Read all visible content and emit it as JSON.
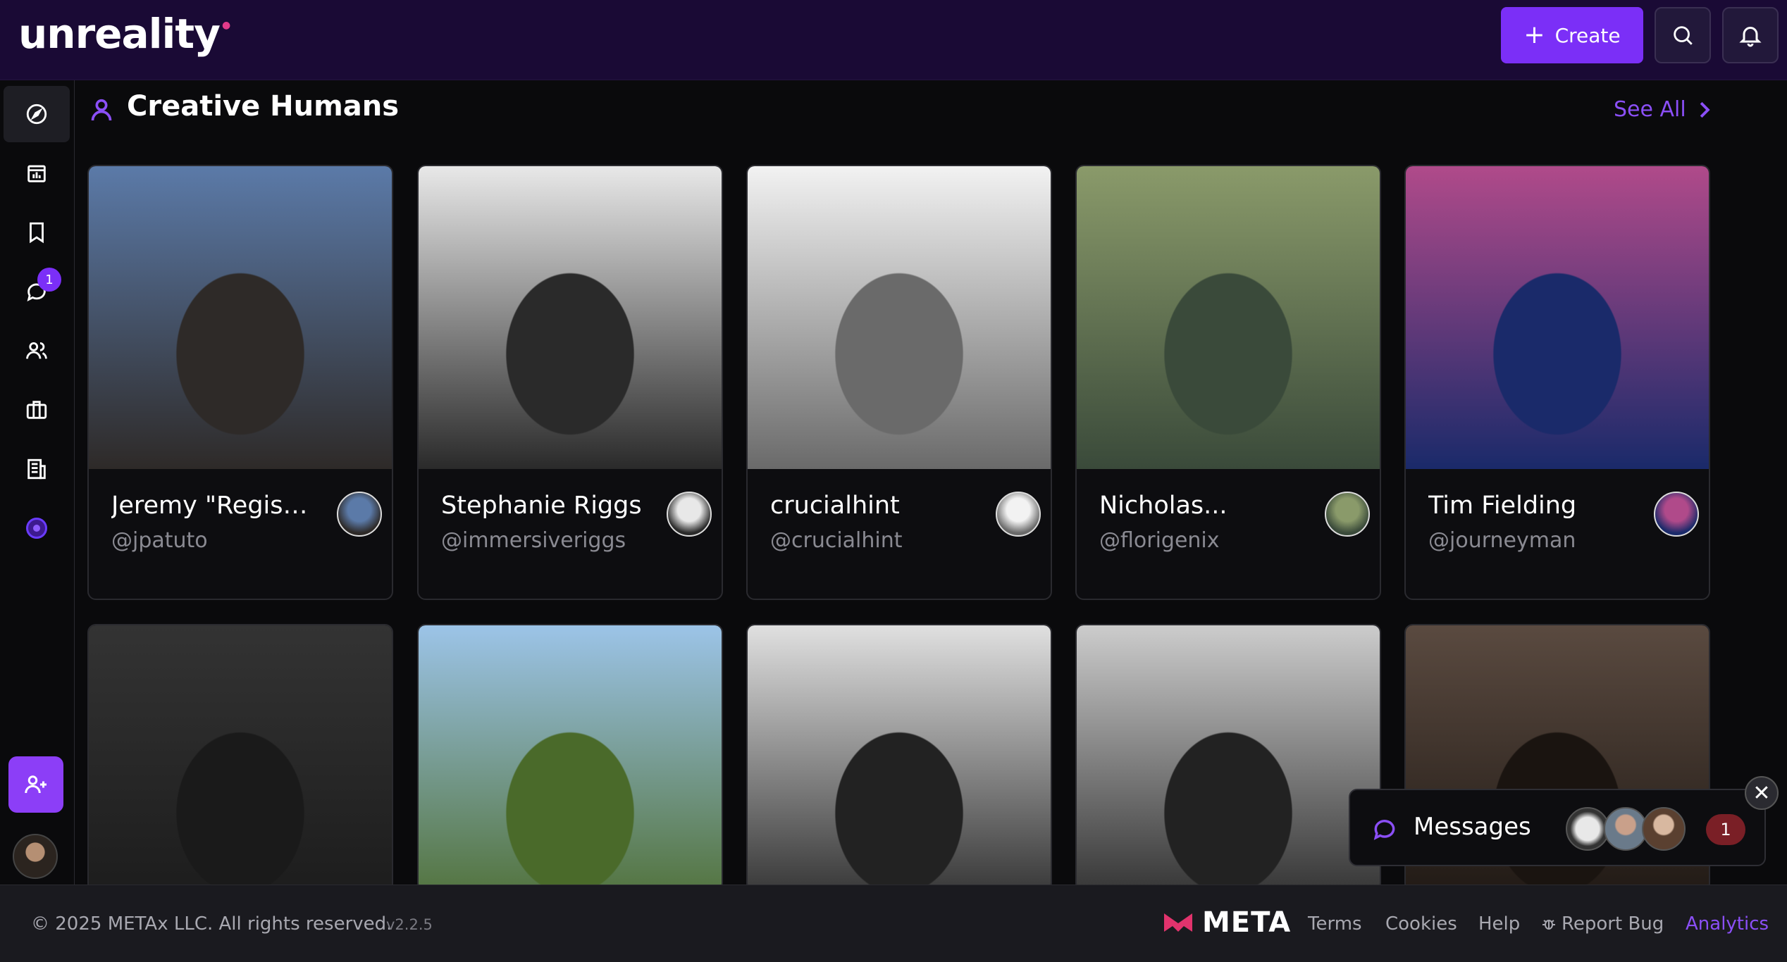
{
  "header": {
    "logo": "unreality",
    "create_label": "Create"
  },
  "sidebar": {
    "messages_badge": "1"
  },
  "section": {
    "title": "Creative Humans",
    "see_all": "See All"
  },
  "creators": [
    {
      "name": "Jeremy \"Regis\"...",
      "handle": "@jpatuto",
      "colors": [
        "#5b7aa8",
        "#2e2a28"
      ]
    },
    {
      "name": "Stephanie Riggs",
      "handle": "@immersiveriggs",
      "colors": [
        "#e8e8e8",
        "#2a2a2a"
      ]
    },
    {
      "name": "crucialhint",
      "handle": "@crucialhint",
      "colors": [
        "#f2f2f2",
        "#6a6a6a"
      ]
    },
    {
      "name": "Nicholas...",
      "handle": "@florigenix",
      "colors": [
        "#8a9a6a",
        "#3a4a3a"
      ]
    },
    {
      "name": "Tim Fielding",
      "handle": "@journeyman",
      "colors": [
        "#b04a8a",
        "#1a2a6a"
      ]
    },
    {
      "name": "",
      "handle": "",
      "colors": [
        "#333333",
        "#1a1a1a"
      ]
    },
    {
      "name": "",
      "handle": "",
      "colors": [
        "#9cc4e8",
        "#4a6a2a"
      ]
    },
    {
      "name": "",
      "handle": "",
      "colors": [
        "#e0e0e0",
        "#222222"
      ]
    },
    {
      "name": "",
      "handle": "",
      "colors": [
        "#cccccc",
        "#222222"
      ]
    },
    {
      "name": "",
      "handle": "",
      "colors": [
        "#5a4a40",
        "#1a1410"
      ]
    }
  ],
  "messages": {
    "label": "Messages",
    "count": "1",
    "close": "✕"
  },
  "footer": {
    "copyright": "© 2025 METAx LLC. All rights reserved.",
    "version": "v2.2.5",
    "meta": "META",
    "terms": "Terms",
    "cookies": "Cookies",
    "help": "Help",
    "report_bug": "Report Bug",
    "analytics": "Analytics"
  },
  "colors": {
    "accent": "#7b2ff7",
    "header_bg": "#1a0a35"
  }
}
